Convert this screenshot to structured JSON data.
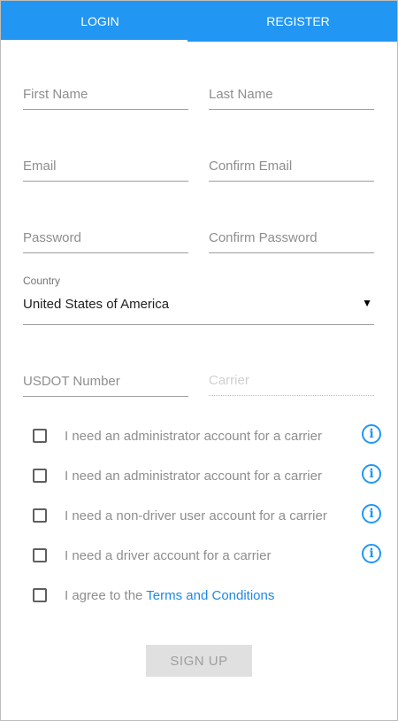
{
  "tabs": {
    "login": "LOGIN",
    "register": "REGISTER"
  },
  "form": {
    "first_name_placeholder": "First Name",
    "last_name_placeholder": "Last Name",
    "email_placeholder": "Email",
    "confirm_email_placeholder": "Confirm Email",
    "password_placeholder": "Password",
    "confirm_password_placeholder": "Confirm Password",
    "country_label": "Country",
    "country_value": "United States of America",
    "usdot_placeholder": "USDOT Number",
    "carrier_placeholder": "Carrier"
  },
  "checkboxes": [
    {
      "label": "I need an administrator account for a carrier",
      "checked": false,
      "info_icon": "info-icon"
    },
    {
      "label": "I need an administrator account for a carrier",
      "checked": false,
      "info_icon": "info-icon"
    },
    {
      "label": "I need a non-driver user account for a carrier",
      "checked": false,
      "info_icon": "info-icon"
    },
    {
      "label": "I need a driver account for a carrier",
      "checked": false,
      "info_icon": "info-icon"
    }
  ],
  "terms": {
    "prefix": "I agree to the ",
    "link": "Terms and Conditions"
  },
  "signup_label": "SIGN UP",
  "colors": {
    "primary": "#2196f3",
    "link": "#1e88e5",
    "disabled_button": "#e0e0e0"
  }
}
